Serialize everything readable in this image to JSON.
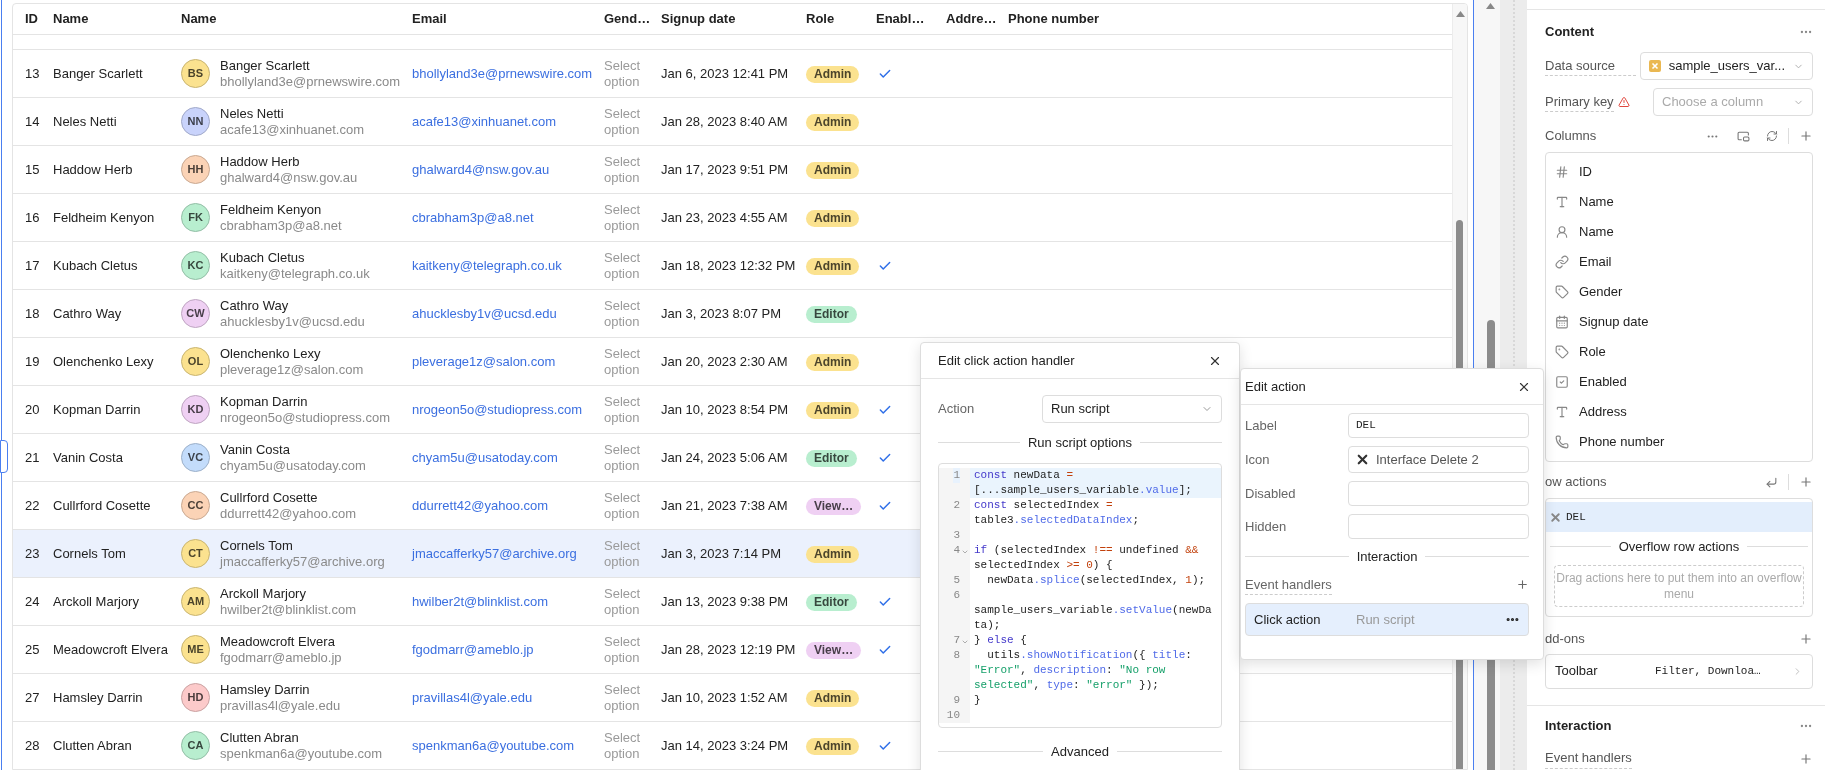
{
  "table": {
    "columns": [
      "ID",
      "Name",
      "Name",
      "Email",
      "Gend…",
      "Signup date",
      "Role",
      "Enabl…",
      "Addre…",
      "Phone number"
    ],
    "rows": [
      {
        "id": "13",
        "name": "Banger Scarlett",
        "avatar": {
          "initials": "BS",
          "color": "#fbe28f"
        },
        "full_name": "Banger Scarlett",
        "sub_email": "bhollyland3e@prnewswire.com",
        "email": "bhollyland3e@prnewswire.com",
        "gender": "Select option",
        "signup": "Jan 6, 2023 12:41 PM",
        "role": {
          "label": "Admin",
          "color": "#fbe28f"
        },
        "enabled": true,
        "selected": false
      },
      {
        "id": "14",
        "name": "Neles Netti",
        "avatar": {
          "initials": "NN",
          "color": "#c9d3fb"
        },
        "full_name": "Neles Netti",
        "sub_email": "acafe13@xinhuanet.com",
        "email": "acafe13@xinhuanet.com",
        "gender": "Select option",
        "signup": "Jan 28, 2023 8:40 AM",
        "role": {
          "label": "Admin",
          "color": "#fbe28f"
        },
        "enabled": false,
        "selected": false
      },
      {
        "id": "15",
        "name": "Haddow Herb",
        "avatar": {
          "initials": "HH",
          "color": "#fbd3b6"
        },
        "full_name": "Haddow Herb",
        "sub_email": "ghalward4@nsw.gov.au",
        "email": "ghalward4@nsw.gov.au",
        "gender": "Select option",
        "signup": "Jan 17, 2023 9:51 PM",
        "role": {
          "label": "Admin",
          "color": "#fbe28f"
        },
        "enabled": false,
        "selected": false
      },
      {
        "id": "16",
        "name": "Feldheim Kenyon",
        "avatar": {
          "initials": "FK",
          "color": "#b8eecf"
        },
        "full_name": "Feldheim Kenyon",
        "sub_email": "cbrabham3p@a8.net",
        "email": "cbrabham3p@a8.net",
        "gender": "Select option",
        "signup": "Jan 23, 2023 4:55 AM",
        "role": {
          "label": "Admin",
          "color": "#fbe28f"
        },
        "enabled": false,
        "selected": false
      },
      {
        "id": "17",
        "name": "Kubach Cletus",
        "avatar": {
          "initials": "KC",
          "color": "#b8eecf"
        },
        "full_name": "Kubach Cletus",
        "sub_email": "kaitkeny@telegraph.co.uk",
        "email": "kaitkeny@telegraph.co.uk",
        "gender": "Select option",
        "signup": "Jan 18, 2023 12:32 PM",
        "role": {
          "label": "Admin",
          "color": "#fbe28f"
        },
        "enabled": true,
        "selected": false
      },
      {
        "id": "18",
        "name": "Cathro Way",
        "avatar": {
          "initials": "CW",
          "color": "#efd0f3"
        },
        "full_name": "Cathro Way",
        "sub_email": "ahucklesby1v@ucsd.edu",
        "email": "ahucklesby1v@ucsd.edu",
        "gender": "Select option",
        "signup": "Jan 3, 2023 8:07 PM",
        "role": {
          "label": "Editor",
          "color": "#b8eecf"
        },
        "enabled": false,
        "selected": false
      },
      {
        "id": "19",
        "name": "Olenchenko Lexy",
        "avatar": {
          "initials": "OL",
          "color": "#fbe28f"
        },
        "full_name": "Olenchenko Lexy",
        "sub_email": "pleverage1z@salon.com",
        "email": "pleverage1z@salon.com",
        "gender": "Select option",
        "signup": "Jan 20, 2023 2:30 AM",
        "role": {
          "label": "Admin",
          "color": "#fbe28f"
        },
        "enabled": false,
        "selected": false
      },
      {
        "id": "20",
        "name": "Kopman Darrin",
        "avatar": {
          "initials": "KD",
          "color": "#efd0f3"
        },
        "full_name": "Kopman Darrin",
        "sub_email": "nrogeon5o@studiopress.com",
        "email": "nrogeon5o@studiopress.com",
        "gender": "Select option",
        "signup": "Jan 10, 2023 8:54 PM",
        "role": {
          "label": "Admin",
          "color": "#fbe28f"
        },
        "enabled": true,
        "selected": false
      },
      {
        "id": "21",
        "name": "Vanin Costa",
        "avatar": {
          "initials": "VC",
          "color": "#c3dcfb"
        },
        "full_name": "Vanin Costa",
        "sub_email": "chyam5u@usatoday.com",
        "email": "chyam5u@usatoday.com",
        "gender": "Select option",
        "signup": "Jan 24, 2023 5:06 AM",
        "role": {
          "label": "Editor",
          "color": "#b8eecf"
        },
        "enabled": true,
        "selected": false
      },
      {
        "id": "22",
        "name": "Cullrford Cosette",
        "avatar": {
          "initials": "CC",
          "color": "#fbd3b6"
        },
        "full_name": "Cullrford Cosette",
        "sub_email": "ddurrett42@yahoo.com",
        "email": "ddurrett42@yahoo.com",
        "gender": "Select option",
        "signup": "Jan 21, 2023 7:38 AM",
        "role": {
          "label": "View…",
          "color": "#efd0f3"
        },
        "enabled": true,
        "selected": false
      },
      {
        "id": "23",
        "name": "Cornels Tom",
        "avatar": {
          "initials": "CT",
          "color": "#fbe28f"
        },
        "full_name": "Cornels Tom",
        "sub_email": "jmaccafferky57@archive.org",
        "email": "jmaccafferky57@archive.org",
        "gender": "Select option",
        "signup": "Jan 3, 2023 7:14 PM",
        "role": {
          "label": "Admin",
          "color": "#fbe28f"
        },
        "enabled": false,
        "selected": true
      },
      {
        "id": "24",
        "name": "Arckoll Marjory",
        "avatar": {
          "initials": "AM",
          "color": "#fbe28f"
        },
        "full_name": "Arckoll Marjory",
        "sub_email": "hwilber2t@blinklist.com",
        "email": "hwilber2t@blinklist.com",
        "gender": "Select option",
        "signup": "Jan 13, 2023 9:38 PM",
        "role": {
          "label": "Editor",
          "color": "#b8eecf"
        },
        "enabled": true,
        "selected": false
      },
      {
        "id": "25",
        "name": "Meadowcroft Elvera",
        "avatar": {
          "initials": "ME",
          "color": "#fbe28f"
        },
        "full_name": "Meadowcroft Elvera",
        "sub_email": "fgodmarr@ameblo.jp",
        "email": "fgodmarr@ameblo.jp",
        "gender": "Select option",
        "signup": "Jan 28, 2023 12:19 PM",
        "role": {
          "label": "View…",
          "color": "#efd0f3"
        },
        "enabled": true,
        "selected": false
      },
      {
        "id": "27",
        "name": "Hamsley Darrin",
        "avatar": {
          "initials": "HD",
          "color": "#fccaca"
        },
        "full_name": "Hamsley Darrin",
        "sub_email": "pravillas4l@yale.edu",
        "email": "pravillas4l@yale.edu",
        "gender": "Select option",
        "signup": "Jan 10, 2023 1:52 AM",
        "role": {
          "label": "Admin",
          "color": "#fbe28f"
        },
        "enabled": false,
        "selected": false
      },
      {
        "id": "28",
        "name": "Clutten Abran",
        "avatar": {
          "initials": "CA",
          "color": "#b8eecf"
        },
        "full_name": "Clutten Abran",
        "sub_email": "spenkman6a@youtube.com",
        "email": "spenkman6a@youtube.com",
        "gender": "Select option",
        "signup": "Jan 14, 2023 3:24 PM",
        "role": {
          "label": "Admin",
          "color": "#fbe28f"
        },
        "enabled": true,
        "selected": false
      }
    ]
  },
  "click_handler": {
    "title": "Edit click action handler",
    "action_label": "Action",
    "action_value": "Run script",
    "options_heading": "Run script options",
    "code": [
      {
        "number": "1",
        "active": true,
        "foldable": false,
        "tokens": [
          {
            "kind": "keyword",
            "text": "const"
          },
          {
            "kind": "plain",
            "text": " newData "
          },
          {
            "kind": "operator",
            "text": "="
          },
          {
            "kind": "plain",
            "text": " [...sample_users_variable"
          },
          {
            "kind": "property",
            "text": ".value"
          },
          {
            "kind": "plain",
            "text": "];"
          }
        ]
      },
      {
        "number": "2",
        "active": false,
        "foldable": false,
        "tokens": [
          {
            "kind": "keyword",
            "text": "const"
          },
          {
            "kind": "plain",
            "text": " selectedIndex "
          },
          {
            "kind": "operator",
            "text": "="
          },
          {
            "kind": "plain",
            "text": " table3"
          },
          {
            "kind": "property",
            "text": ".selectedDataIndex"
          },
          {
            "kind": "plain",
            "text": ";"
          }
        ]
      },
      {
        "number": "3",
        "active": false,
        "foldable": false
      },
      {
        "number": "4",
        "active": false,
        "foldable": true,
        "tokens": [
          {
            "kind": "keyword",
            "text": "if"
          },
          {
            "kind": "plain",
            "text": " (selectedIndex "
          },
          {
            "kind": "operator",
            "text": "!=="
          },
          {
            "kind": "plain",
            "text": " undefined "
          },
          {
            "kind": "operator",
            "text": "&&"
          },
          {
            "kind": "plain",
            "text": " selectedIndex "
          },
          {
            "kind": "operator",
            "text": ">= "
          },
          {
            "kind": "number",
            "text": "0"
          },
          {
            "kind": "plain",
            "text": ") {"
          }
        ]
      },
      {
        "number": "5",
        "active": false,
        "foldable": false,
        "tokens": [
          {
            "kind": "plain",
            "text": "  newData"
          },
          {
            "kind": "property",
            "text": ".splice"
          },
          {
            "kind": "plain",
            "text": "(selectedIndex, "
          },
          {
            "kind": "number",
            "text": "1"
          },
          {
            "kind": "plain",
            "text": ");"
          }
        ]
      },
      {
        "number": "6",
        "active": false,
        "foldable": false,
        "tokens": [
          {
            "kind": "plain",
            "text": "  sample_users_variable"
          },
          {
            "kind": "property",
            "text": ".setValue"
          },
          {
            "kind": "plain",
            "text": "(newData);"
          }
        ]
      },
      {
        "number": "7",
        "active": false,
        "foldable": true,
        "tokens": [
          {
            "kind": "plain",
            "text": "} "
          },
          {
            "kind": "keyword",
            "text": "else"
          },
          {
            "kind": "plain",
            "text": " {"
          }
        ]
      },
      {
        "number": "8",
        "active": false,
        "foldable": false,
        "tokens": [
          {
            "kind": "plain",
            "text": "  utils"
          },
          {
            "kind": "property",
            "text": ".showNotification"
          },
          {
            "kind": "plain",
            "text": "({ "
          },
          {
            "kind": "property",
            "text": "title"
          },
          {
            "kind": "plain",
            "text": ": "
          },
          {
            "kind": "string",
            "text": "\"Error\""
          },
          {
            "kind": "plain",
            "text": ", "
          },
          {
            "kind": "property",
            "text": "description"
          },
          {
            "kind": "plain",
            "text": ": "
          },
          {
            "kind": "string",
            "text": "\"No row selected\""
          },
          {
            "kind": "plain",
            "text": ", "
          },
          {
            "kind": "property",
            "text": "type"
          },
          {
            "kind": "plain",
            "text": ": "
          },
          {
            "kind": "string",
            "text": "\"error\""
          },
          {
            "kind": "plain",
            "text": " });"
          }
        ]
      },
      {
        "number": "9",
        "active": false,
        "foldable": false,
        "tokens": [
          {
            "kind": "plain",
            "text": "}"
          }
        ]
      },
      {
        "number": "10",
        "active": false,
        "foldable": false
      }
    ],
    "advanced_heading": "Advanced"
  },
  "edit_action": {
    "title": "Edit action",
    "fields": [
      {
        "label": "Label",
        "kind": "text",
        "value": "DEL"
      },
      {
        "label": "Icon",
        "kind": "icon",
        "value": "Interface Delete 2"
      },
      {
        "label": "Disabled",
        "kind": "text"
      },
      {
        "label": "Hidden",
        "kind": "text"
      }
    ],
    "interaction_heading": "Interaction",
    "event_handlers_label": "Event handlers",
    "handlers": [
      {
        "name": "Click action",
        "action": "Run script",
        "selected": true
      }
    ]
  },
  "inspector": {
    "content_title": "Content",
    "data_source": {
      "label": "Data source",
      "value": "sample_users_var..."
    },
    "primary_key": {
      "label": "Primary key",
      "placeholder": "Choose a column"
    },
    "columns_label": "Columns",
    "columns": [
      {
        "label": "ID",
        "kind": "number"
      },
      {
        "label": "Name",
        "kind": "text"
      },
      {
        "label": "Name",
        "kind": "avatar"
      },
      {
        "label": "Email",
        "kind": "link"
      },
      {
        "label": "Gender",
        "kind": "tag"
      },
      {
        "label": "Signup date",
        "kind": "date"
      },
      {
        "label": "Role",
        "kind": "tag"
      },
      {
        "label": "Enabled",
        "kind": "boolean"
      },
      {
        "label": "Address",
        "kind": "text"
      },
      {
        "label": "Phone number",
        "kind": "phone"
      }
    ],
    "row_actions_label": "ow actions",
    "row_actions": [
      {
        "label": "DEL",
        "selected": true
      }
    ],
    "overflow_heading": "Overflow row actions",
    "overflow_hint": "Drag actions here to put them into an overflow menu",
    "addons_label": "dd-ons",
    "addons": [
      {
        "label": "Toolbar",
        "value": "Filter, Downloa…"
      }
    ],
    "interaction_title": "Interaction",
    "event_handlers_label": "Event handlers"
  }
}
